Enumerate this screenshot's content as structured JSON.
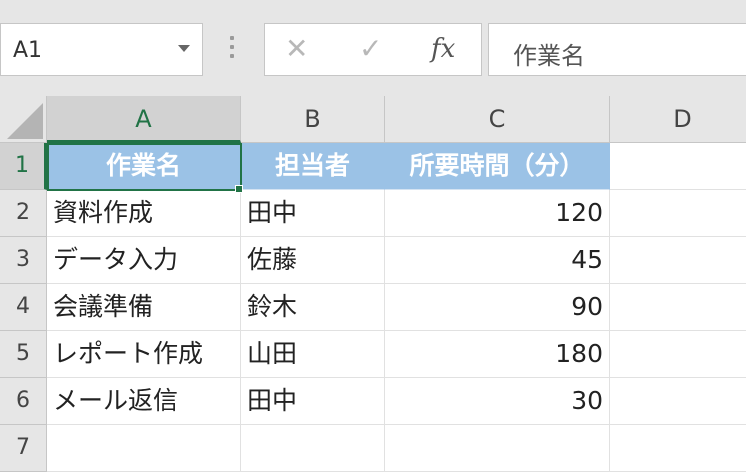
{
  "name_box": {
    "value": "A1"
  },
  "formula_bar": {
    "cancel_glyph": "✕",
    "enter_glyph": "✓",
    "fx_label": "fx",
    "value": "作業名"
  },
  "columns": [
    "A",
    "B",
    "C",
    "D"
  ],
  "rows": [
    "1",
    "2",
    "3",
    "4",
    "5",
    "6",
    "7"
  ],
  "table": {
    "header": [
      "作業名",
      "担当者",
      "所要時間（分）"
    ],
    "data": [
      [
        "資料作成",
        "田中",
        "120"
      ],
      [
        "データ入力",
        "佐藤",
        "45"
      ],
      [
        "会議準備",
        "鈴木",
        "90"
      ],
      [
        "レポート作成",
        "山田",
        "180"
      ],
      [
        "メール返信",
        "田中",
        "30"
      ]
    ]
  },
  "colors": {
    "header_fill": "#9bc2e6",
    "selection": "#217346"
  }
}
